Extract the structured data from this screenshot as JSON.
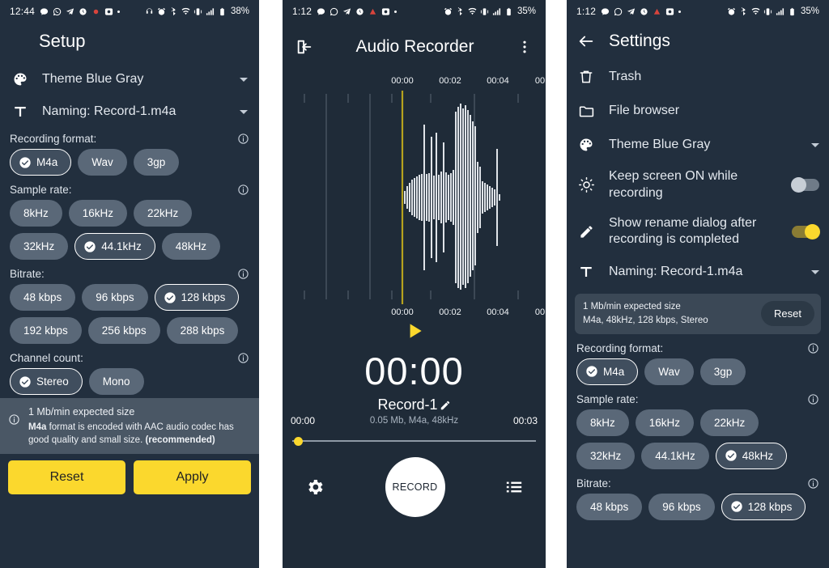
{
  "panels": {
    "setup": {
      "statusbar": {
        "time": "12:44",
        "battery": "38%"
      },
      "title": "Setup",
      "theme_row": {
        "label": "Theme Blue Gray",
        "icon": "palette-icon"
      },
      "naming_row": {
        "label": "Naming: Record-1.m4a",
        "icon": "text-format-icon"
      },
      "sections": [
        {
          "label": "Recording format:",
          "chips": [
            {
              "label": "M4a",
              "selected": true
            },
            {
              "label": "Wav",
              "selected": false
            },
            {
              "label": "3gp",
              "selected": false
            }
          ]
        },
        {
          "label": "Sample rate:",
          "chips": [
            {
              "label": "8kHz",
              "selected": false
            },
            {
              "label": "16kHz",
              "selected": false
            },
            {
              "label": "22kHz",
              "selected": false
            },
            {
              "label": "32kHz",
              "selected": false
            },
            {
              "label": "44.1kHz",
              "selected": true
            },
            {
              "label": "48kHz",
              "selected": false
            }
          ]
        },
        {
          "label": "Bitrate:",
          "chips": [
            {
              "label": "48 kbps",
              "selected": false
            },
            {
              "label": "96 kbps",
              "selected": false
            },
            {
              "label": "128 kbps",
              "selected": true
            },
            {
              "label": "192 kbps",
              "selected": false
            },
            {
              "label": "256 kbps",
              "selected": false
            },
            {
              "label": "288 kbps",
              "selected": false
            }
          ]
        },
        {
          "label": "Channel count:",
          "chips": [
            {
              "label": "Stereo",
              "selected": true
            },
            {
              "label": "Mono",
              "selected": false
            }
          ]
        }
      ],
      "info": {
        "line1": "1 Mb/min expected size",
        "bold_prefix": "M4a",
        "body": " format is encoded with AAC audio codec has good quality and small size. ",
        "bold_suffix": "(recommended)"
      },
      "reset_label": "Reset",
      "apply_label": "Apply"
    },
    "recorder": {
      "statusbar": {
        "time": "1:12",
        "battery": "35%"
      },
      "title": "Audio Recorder",
      "waveform_ticks": [
        "00:00",
        "00:02",
        "00:04",
        "00"
      ],
      "timer": "00:00",
      "record_name": "Record-1",
      "time_start": "00:00",
      "time_end": "00:03",
      "file_meta": "0.05 Mb, M4a, 48kHz",
      "record_button": "RECORD"
    },
    "settings": {
      "statusbar": {
        "time": "1:12",
        "battery": "35%"
      },
      "title": "Settings",
      "rows": [
        {
          "label": "Trash",
          "icon": "trash-icon",
          "type": "nav"
        },
        {
          "label": "File browser",
          "icon": "folder-icon",
          "type": "nav"
        },
        {
          "label": "Theme Blue Gray",
          "icon": "palette-icon",
          "type": "dropdown"
        },
        {
          "label": "Keep screen ON while recording",
          "icon": "brightness-icon",
          "type": "toggle",
          "on": false
        },
        {
          "label": "Show rename dialog after recording is completed",
          "icon": "pencil-icon",
          "type": "toggle",
          "on": true
        },
        {
          "label": "Naming: Record-1.m4a",
          "icon": "text-format-icon",
          "type": "dropdown"
        }
      ],
      "reset_card": {
        "line1": "1 Mb/min expected size",
        "line2": "M4a, 48kHz, 128 kbps, Stereo",
        "button": "Reset"
      },
      "sections": [
        {
          "label": "Recording format:",
          "chips": [
            {
              "label": "M4a",
              "selected": true
            },
            {
              "label": "Wav",
              "selected": false
            },
            {
              "label": "3gp",
              "selected": false
            }
          ]
        },
        {
          "label": "Sample rate:",
          "chips": [
            {
              "label": "8kHz",
              "selected": false
            },
            {
              "label": "16kHz",
              "selected": false
            },
            {
              "label": "22kHz",
              "selected": false
            },
            {
              "label": "32kHz",
              "selected": false
            },
            {
              "label": "44.1kHz",
              "selected": false
            },
            {
              "label": "48kHz",
              "selected": true
            }
          ]
        },
        {
          "label": "Bitrate:",
          "chips": [
            {
              "label": "48 kbps",
              "selected": false
            },
            {
              "label": "96 kbps",
              "selected": false
            },
            {
              "label": "128 kbps",
              "selected": true
            }
          ]
        }
      ]
    }
  },
  "colors": {
    "accent": "#fbd82d",
    "background": "#222f3e",
    "chip": "#5a6878",
    "chip_selected": "#404e5e"
  }
}
